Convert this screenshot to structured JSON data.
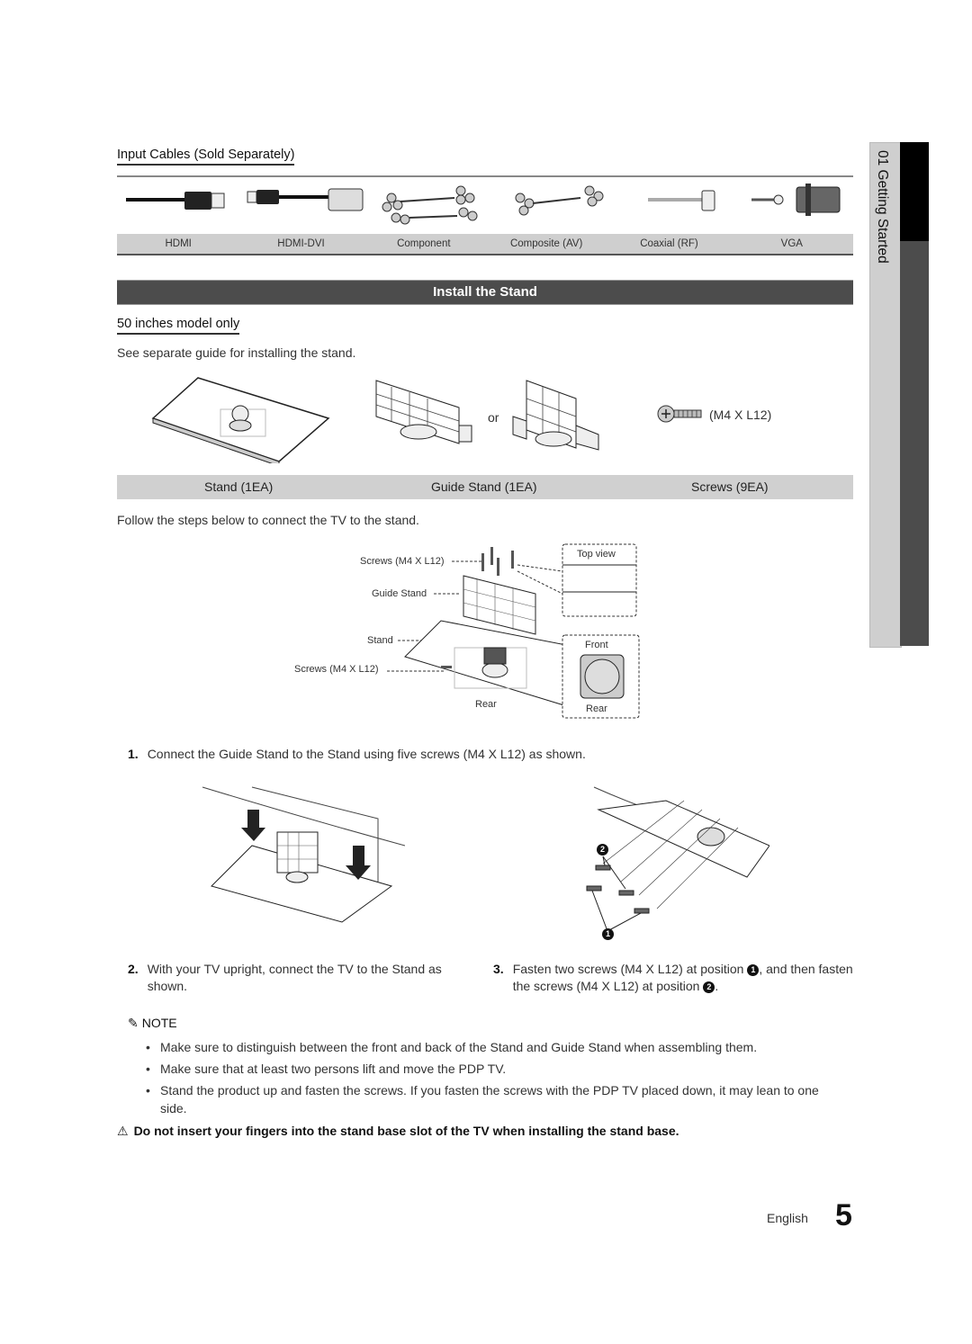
{
  "side_tab": {
    "chapter": "01  Getting Started"
  },
  "input_cables": {
    "heading": "Input Cables (Sold Separately)",
    "cables": [
      "HDMI",
      "HDMI-DVI",
      "Component",
      "Composite (AV)",
      "Coaxial (RF)",
      "VGA"
    ]
  },
  "section": {
    "title": "Install the Stand",
    "model_note": "50 inches model only",
    "guide_note": "See separate guide for installing the stand.",
    "or_label": "or",
    "screw_spec": "(M4 X L12)",
    "parts": [
      "Stand (1EA)",
      "Guide Stand (1EA)",
      "Screws (9EA)"
    ],
    "follow_text": "Follow the steps below to connect the TV to the stand."
  },
  "diagram": {
    "labels": {
      "screws_top": "Screws (M4 X L12)",
      "guide_stand": "Guide Stand",
      "stand": "Stand",
      "screws_bottom": "Screws (M4 X L12)",
      "rear": "Rear",
      "top_view": "Top view",
      "front": "Front",
      "rear_detail": "Rear"
    }
  },
  "steps": [
    {
      "num": "1.",
      "text": "Connect the Guide Stand to the Stand using five screws (M4 X L12) as shown."
    },
    {
      "num": "2.",
      "text": "With your TV upright, connect the TV to the Stand as shown."
    },
    {
      "num": "3.",
      "text_a": "Fasten two screws (M4 X L12) at position ",
      "pos1": "1",
      "text_b": ", and then fasten the screws (M4 X L12) at position ",
      "pos2": "2",
      "text_c": "."
    }
  ],
  "note": {
    "label": "NOTE",
    "items": [
      "Make sure to distinguish between the front and back of the Stand and Guide Stand when assembling them.",
      "Make sure that at least two persons lift and move the PDP TV.",
      "Stand the product up and fasten the screws. If you fasten the screws with the PDP TV placed down, it may lean to one side."
    ]
  },
  "warning": "Do not insert your fingers into the stand base slot of the TV when installing the stand base.",
  "footer": {
    "language": "English",
    "page_number": "5"
  },
  "callouts": {
    "one": "1",
    "two": "2"
  }
}
